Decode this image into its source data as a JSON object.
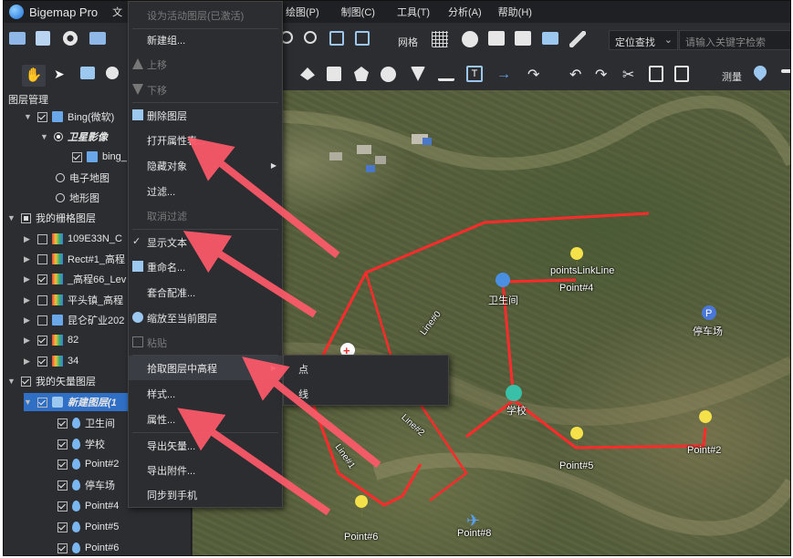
{
  "app": {
    "title": "Bigemap Pro"
  },
  "menubar": {
    "file_partial": "文",
    "items_right": [
      "绘图(P)",
      "制图(C)",
      "工具(T)",
      "分析(A)",
      "帮助(H)"
    ]
  },
  "toolbar1": {
    "grid_label": "网格",
    "locate_label": "定位查找",
    "search_placeholder": "请输入关键字检索"
  },
  "toolbar2": {
    "measure_label": "测量"
  },
  "sidebar": {
    "title": "图层管理",
    "rows": [
      {
        "label": "Bing(微软)",
        "indent": 0
      },
      {
        "label": "卫星影像",
        "indent": 1
      },
      {
        "label": "bing_",
        "indent": 2
      },
      {
        "label": "电子地图",
        "indent": 1
      },
      {
        "label": "地形图",
        "indent": 1
      },
      {
        "label": "我的栅格图层",
        "indent": 0
      },
      {
        "label": "109E33N_C",
        "indent": 1
      },
      {
        "label": "Rect#1_高程",
        "indent": 1
      },
      {
        "label": "_高程66_Lev",
        "indent": 1
      },
      {
        "label": "平头镇_高程",
        "indent": 1
      },
      {
        "label": "昆仑矿业202",
        "indent": 1
      },
      {
        "label": "82",
        "indent": 1
      },
      {
        "label": "34",
        "indent": 1
      },
      {
        "label": "我的矢量图层",
        "indent": 0
      },
      {
        "label": "新建图层(1",
        "indent": 1
      },
      {
        "label": "卫生间",
        "indent": 2
      },
      {
        "label": "学校",
        "indent": 2
      },
      {
        "label": "Point#2",
        "indent": 2
      },
      {
        "label": "停车场",
        "indent": 2
      },
      {
        "label": "Point#4",
        "indent": 2
      },
      {
        "label": "Point#5",
        "indent": 2
      },
      {
        "label": "Point#6",
        "indent": 2
      }
    ]
  },
  "context_menu": {
    "items": [
      {
        "label": "设为活动图层(已激活)",
        "disabled": true
      },
      {
        "label": "新建组..."
      },
      {
        "label": "上移",
        "disabled": true
      },
      {
        "label": "下移",
        "disabled": true
      },
      {
        "label": "删除图层"
      },
      {
        "label": "打开属性表..."
      },
      {
        "label": "隐藏对象"
      },
      {
        "label": "过滤..."
      },
      {
        "label": "取消过滤",
        "disabled": true
      },
      {
        "label": "显示文本"
      },
      {
        "label": "重命名..."
      },
      {
        "label": "套合配准..."
      },
      {
        "label": "缩放至当前图层"
      },
      {
        "label": "粘贴",
        "disabled": true
      },
      {
        "label": "拾取图层中高程"
      },
      {
        "label": "样式..."
      },
      {
        "label": "属性..."
      },
      {
        "label": "导出矢量..."
      },
      {
        "label": "导出附件..."
      },
      {
        "label": "同步到手机"
      }
    ],
    "checkmark": "✓"
  },
  "submenu": {
    "items": [
      "点",
      "线"
    ]
  },
  "map": {
    "labels": {
      "toilet": "卫生间",
      "school": "学校",
      "parking": "停车场",
      "point2": "Point#2",
      "point4": "Point#4",
      "point5": "Point#5",
      "point6": "Point#6",
      "point8": "Point#8",
      "link": "pointsLinkLine",
      "line0": "Line#0",
      "line1": "Line#1",
      "line2": "Line#2"
    },
    "route_color": "#ff2a2a"
  },
  "annotation": {
    "arrow_color": "#ff5a6a"
  }
}
